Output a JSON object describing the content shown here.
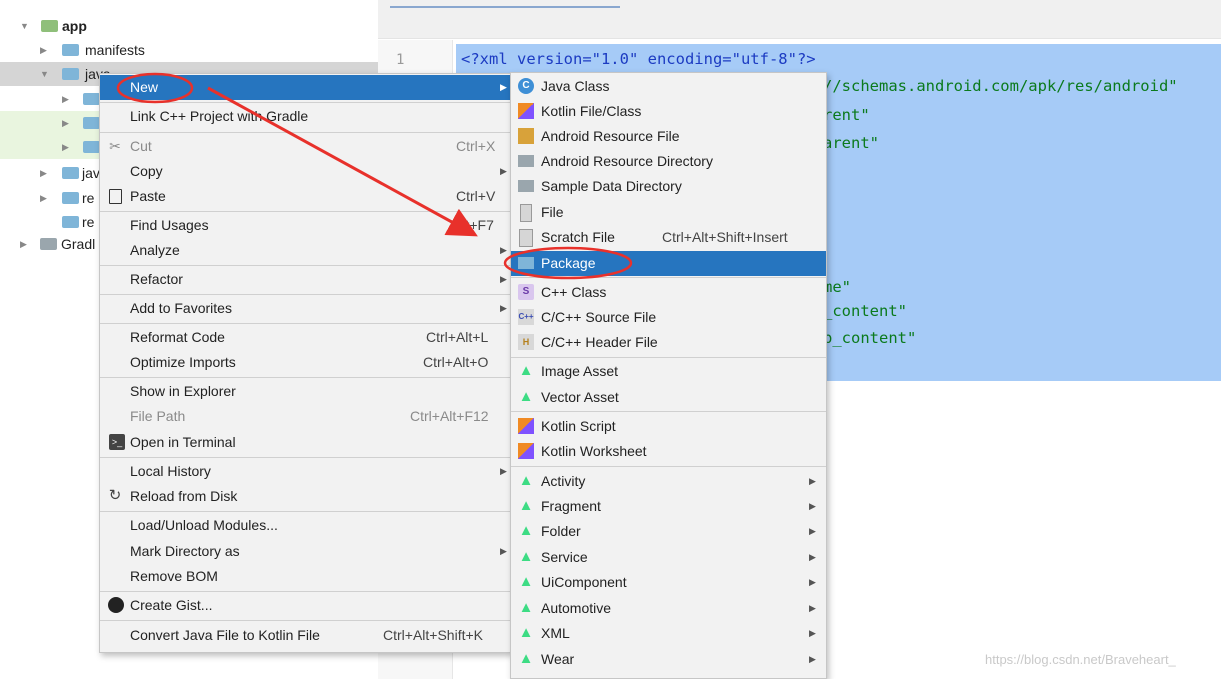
{
  "tree": {
    "items": [
      {
        "label": "app",
        "arrow": "▼",
        "bold": true
      },
      {
        "label": "manifests",
        "arrow": "▶"
      },
      {
        "label": "java",
        "arrow": "▼"
      },
      {
        "label": "",
        "arrow": "▶"
      },
      {
        "label": "",
        "arrow": "▶"
      },
      {
        "label": "",
        "arrow": "▶"
      },
      {
        "label": "jav",
        "arrow": "▶"
      },
      {
        "label": "re",
        "arrow": "▶"
      },
      {
        "label": "re",
        "arrow": ""
      },
      {
        "label": "Gradl",
        "arrow": "▶"
      }
    ]
  },
  "editor": {
    "line_number": "1",
    "lines": [
      {
        "kw": "<?xml version=\"1.0\" encoding=\"utf-8\"?>",
        "rest": ""
      },
      {
        "kw": "",
        "rest": "//schemas.android.com/apk/res/android\""
      },
      {
        "kw": "",
        "rest": "rent\""
      },
      {
        "kw": "",
        "rest": "arent\""
      },
      {
        "kw": "",
        "rest": "me\""
      },
      {
        "kw": "",
        "rest": "_content\""
      },
      {
        "kw": "",
        "rest": "p_content\""
      }
    ]
  },
  "context_menu": {
    "items": [
      {
        "label": "New",
        "shortcut": "",
        "submenu": true
      },
      {
        "label": "Link C++ Project with Gradle",
        "shortcut": ""
      },
      {
        "label": "Cut",
        "shortcut": "Ctrl+X"
      },
      {
        "label": "Copy",
        "shortcut": "",
        "submenu": true
      },
      {
        "label": "Paste",
        "shortcut": "Ctrl+V"
      },
      {
        "label": "Find Usages",
        "shortcut": "Alt+F7"
      },
      {
        "label": "Analyze",
        "shortcut": "",
        "submenu": true
      },
      {
        "label": "Refactor",
        "shortcut": "",
        "submenu": true
      },
      {
        "label": "Add to Favorites",
        "shortcut": "",
        "submenu": true
      },
      {
        "label": "Reformat Code",
        "shortcut": "Ctrl+Alt+L"
      },
      {
        "label": "Optimize Imports",
        "shortcut": "Ctrl+Alt+O"
      },
      {
        "label": "Show in Explorer",
        "shortcut": ""
      },
      {
        "label": "File Path",
        "shortcut": "Ctrl+Alt+F12"
      },
      {
        "label": "Open in Terminal",
        "shortcut": ""
      },
      {
        "label": "Local History",
        "shortcut": "",
        "submenu": true
      },
      {
        "label": "Reload from Disk",
        "shortcut": ""
      },
      {
        "label": "Load/Unload Modules...",
        "shortcut": ""
      },
      {
        "label": "Mark Directory as",
        "shortcut": "",
        "submenu": true
      },
      {
        "label": "Remove BOM",
        "shortcut": ""
      },
      {
        "label": "Create Gist...",
        "shortcut": ""
      },
      {
        "label": "Convert Java File to Kotlin File",
        "shortcut": "Ctrl+Alt+Shift+K"
      }
    ]
  },
  "new_submenu": {
    "items": [
      {
        "label": "Java Class",
        "shortcut": ""
      },
      {
        "label": "Kotlin File/Class",
        "shortcut": ""
      },
      {
        "label": "Android Resource File",
        "shortcut": ""
      },
      {
        "label": "Android Resource Directory",
        "shortcut": ""
      },
      {
        "label": "Sample Data Directory",
        "shortcut": ""
      },
      {
        "label": "File",
        "shortcut": ""
      },
      {
        "label": "Scratch File",
        "shortcut": "Ctrl+Alt+Shift+Insert"
      },
      {
        "label": "Package",
        "shortcut": ""
      },
      {
        "label": "C++ Class",
        "shortcut": ""
      },
      {
        "label": "C/C++ Source File",
        "shortcut": ""
      },
      {
        "label": "C/C++ Header File",
        "shortcut": ""
      },
      {
        "label": "Image Asset",
        "shortcut": ""
      },
      {
        "label": "Vector Asset",
        "shortcut": ""
      },
      {
        "label": "Kotlin Script",
        "shortcut": ""
      },
      {
        "label": "Kotlin Worksheet",
        "shortcut": ""
      },
      {
        "label": "Activity",
        "shortcut": "",
        "submenu": true
      },
      {
        "label": "Fragment",
        "shortcut": "",
        "submenu": true
      },
      {
        "label": "Folder",
        "shortcut": "",
        "submenu": true
      },
      {
        "label": "Service",
        "shortcut": "",
        "submenu": true
      },
      {
        "label": "UiComponent",
        "shortcut": "",
        "submenu": true
      },
      {
        "label": "Automotive",
        "shortcut": "",
        "submenu": true
      },
      {
        "label": "XML",
        "shortcut": "",
        "submenu": true
      },
      {
        "label": "Wear",
        "shortcut": "",
        "submenu": true
      }
    ]
  },
  "icons": {
    "java_class": "java-class-icon",
    "android": "android-icon",
    "kotlin": "kotlin-icon"
  },
  "colors": {
    "highlight": "#2675bf",
    "annotation": "#e8312b",
    "selection": "#a6cbf7"
  },
  "watermark": "https://blog.csdn.net/Braveheart_"
}
